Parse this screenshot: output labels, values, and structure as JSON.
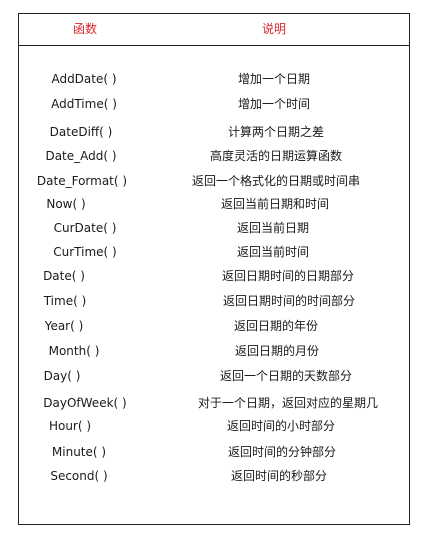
{
  "colors": {
    "header_text": "#d9252b",
    "border": "#222222",
    "body_text": "#1a1a1a"
  },
  "table": {
    "headers": {
      "function": "函数",
      "description": "说明"
    },
    "rows": [
      {
        "func": "AddDate( )",
        "desc": "增加一个日期"
      },
      {
        "func": "AddTime( )",
        "desc": "增加一个时间"
      },
      {
        "func": "DateDiff( )",
        "desc": "计算两个日期之差"
      },
      {
        "func": "Date_Add( )",
        "desc": "高度灵活的日期运算函数"
      },
      {
        "func": "Date_Format( )",
        "desc": "返回一个格式化的日期或时间串"
      },
      {
        "func": "Now( )",
        "desc": "返回当前日期和时间"
      },
      {
        "func": "CurDate( )",
        "desc": "返回当前日期"
      },
      {
        "func": "CurTime( )",
        "desc": "返回当前时间"
      },
      {
        "func": "Date( )",
        "desc": "返回日期时间的日期部分"
      },
      {
        "func": "Time( )",
        "desc": "返回日期时间的时间部分"
      },
      {
        "func": "Year( )",
        "desc": "返回日期的年份"
      },
      {
        "func": "Month( )",
        "desc": "返回日期的月份"
      },
      {
        "func": "Day( )",
        "desc": "返回一个日期的天数部分"
      },
      {
        "func": "DayOfWeek( )",
        "desc": "对于一个日期，返回对应的星期几"
      },
      {
        "func": "Hour( )",
        "desc": "返回时间的小时部分"
      },
      {
        "func": "Minute( )",
        "desc": "返回时间的分钟部分"
      },
      {
        "func": "Second( )",
        "desc": "返回时间的秒部分"
      }
    ]
  }
}
